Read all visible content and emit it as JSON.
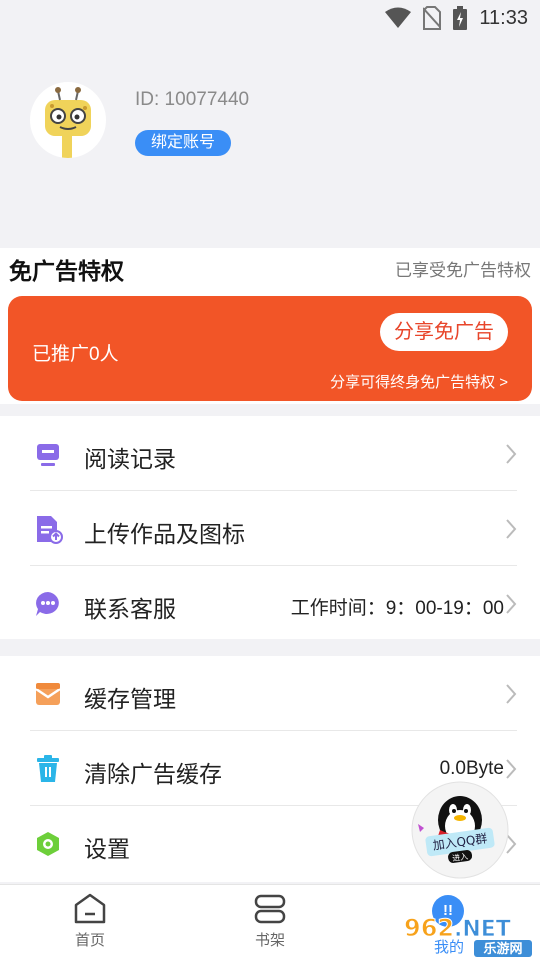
{
  "status_bar": {
    "time": "11:33",
    "icons": [
      "wifi-icon",
      "no-sim-icon",
      "battery-charging-icon"
    ]
  },
  "profile": {
    "user_id": "ID: 10077440",
    "bind_label": "绑定账号"
  },
  "privilege": {
    "title": "免广告特权",
    "status": "已享受免广告特权",
    "promoted_count": "已推广0人",
    "share_button": "分享免广告",
    "note": "分享可得终身免广告特权 >"
  },
  "menu_group_1": [
    {
      "label": "阅读记录",
      "icon": "reading-history-icon",
      "value": ""
    },
    {
      "label": "上传作品及图标",
      "icon": "upload-icon",
      "value": ""
    },
    {
      "label": "联系客服",
      "icon": "customer-service-icon",
      "value": "工作时间：9：00-19：00"
    }
  ],
  "menu_group_2": [
    {
      "label": "缓存管理",
      "icon": "cache-icon",
      "value": ""
    },
    {
      "label": "清除广告缓存",
      "icon": "trash-icon",
      "value": "0.0Byte"
    },
    {
      "label": "设置",
      "icon": "settings-icon",
      "value": ""
    }
  ],
  "qq_float": {
    "text": "加入QQ群",
    "sub": "进入"
  },
  "bottom_nav": {
    "home": "首页",
    "bookshelf": "书架",
    "mine": "我的"
  },
  "watermark": {
    "text": "962.NET",
    "sub": "乐游网"
  },
  "colors": {
    "accent": "#3a8ef6",
    "promo": "#f25527",
    "icon_purple": "#8a6be8"
  }
}
